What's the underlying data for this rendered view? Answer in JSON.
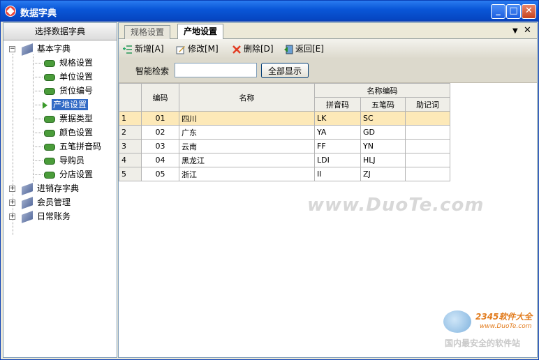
{
  "window": {
    "title": "数据字典",
    "min": "_",
    "max": "□",
    "close": "✕"
  },
  "sidebar": {
    "header": "选择数据字典",
    "groups": [
      {
        "label": "基本字典",
        "expander": "−",
        "items": [
          {
            "label": "规格设置"
          },
          {
            "label": "单位设置"
          },
          {
            "label": "货位编号"
          },
          {
            "label": "产地设置",
            "selected": true
          },
          {
            "label": "票据类型"
          },
          {
            "label": "颜色设置"
          },
          {
            "label": "五笔拼音码"
          },
          {
            "label": "导购员"
          },
          {
            "label": "分店设置"
          }
        ]
      },
      {
        "label": "进销存字典",
        "expander": "+"
      },
      {
        "label": "会员管理",
        "expander": "+"
      },
      {
        "label": "日常账务",
        "expander": "+"
      }
    ]
  },
  "tabs": [
    {
      "label": "规格设置",
      "active": false
    },
    {
      "label": "产地设置",
      "active": true
    }
  ],
  "tab_controls": {
    "dropdown": "▼",
    "close": "✕"
  },
  "toolbar": {
    "add": "新增[A]",
    "edit": "修改[M]",
    "delete": "删除[D]",
    "back": "返回[E]"
  },
  "search": {
    "label": "智能检索",
    "value": "",
    "placeholder": "",
    "show_all": "全部显示"
  },
  "table": {
    "headers": {
      "code": "编码",
      "name": "名称",
      "name_code": "名称编码",
      "pinyin": "拼音码",
      "wubi": "五笔码",
      "memo": "助记词"
    },
    "rows": [
      {
        "num": "1",
        "code": "01",
        "name": "四川",
        "pinyin": "LK",
        "wubi": "SC",
        "memo": ""
      },
      {
        "num": "2",
        "code": "02",
        "name": "广东",
        "pinyin": "YA",
        "wubi": "GD",
        "memo": ""
      },
      {
        "num": "3",
        "code": "03",
        "name": "云南",
        "pinyin": "FF",
        "wubi": "YN",
        "memo": ""
      },
      {
        "num": "4",
        "code": "04",
        "name": "黑龙江",
        "pinyin": "LDI",
        "wubi": "HLJ",
        "memo": ""
      },
      {
        "num": "5",
        "code": "05",
        "name": "浙江",
        "pinyin": "II",
        "wubi": "ZJ",
        "memo": ""
      }
    ]
  },
  "watermark": "www.DuoTe.com",
  "logo": {
    "brand": "2345软件大全",
    "site": "www.DuoTe.com",
    "slogan": "国内最安全的软件站"
  },
  "colors": {
    "titlebar": "#0a57d8",
    "selection": "#316ac5",
    "row_highlight": "#fde9b8",
    "close_red": "#e23b22"
  }
}
